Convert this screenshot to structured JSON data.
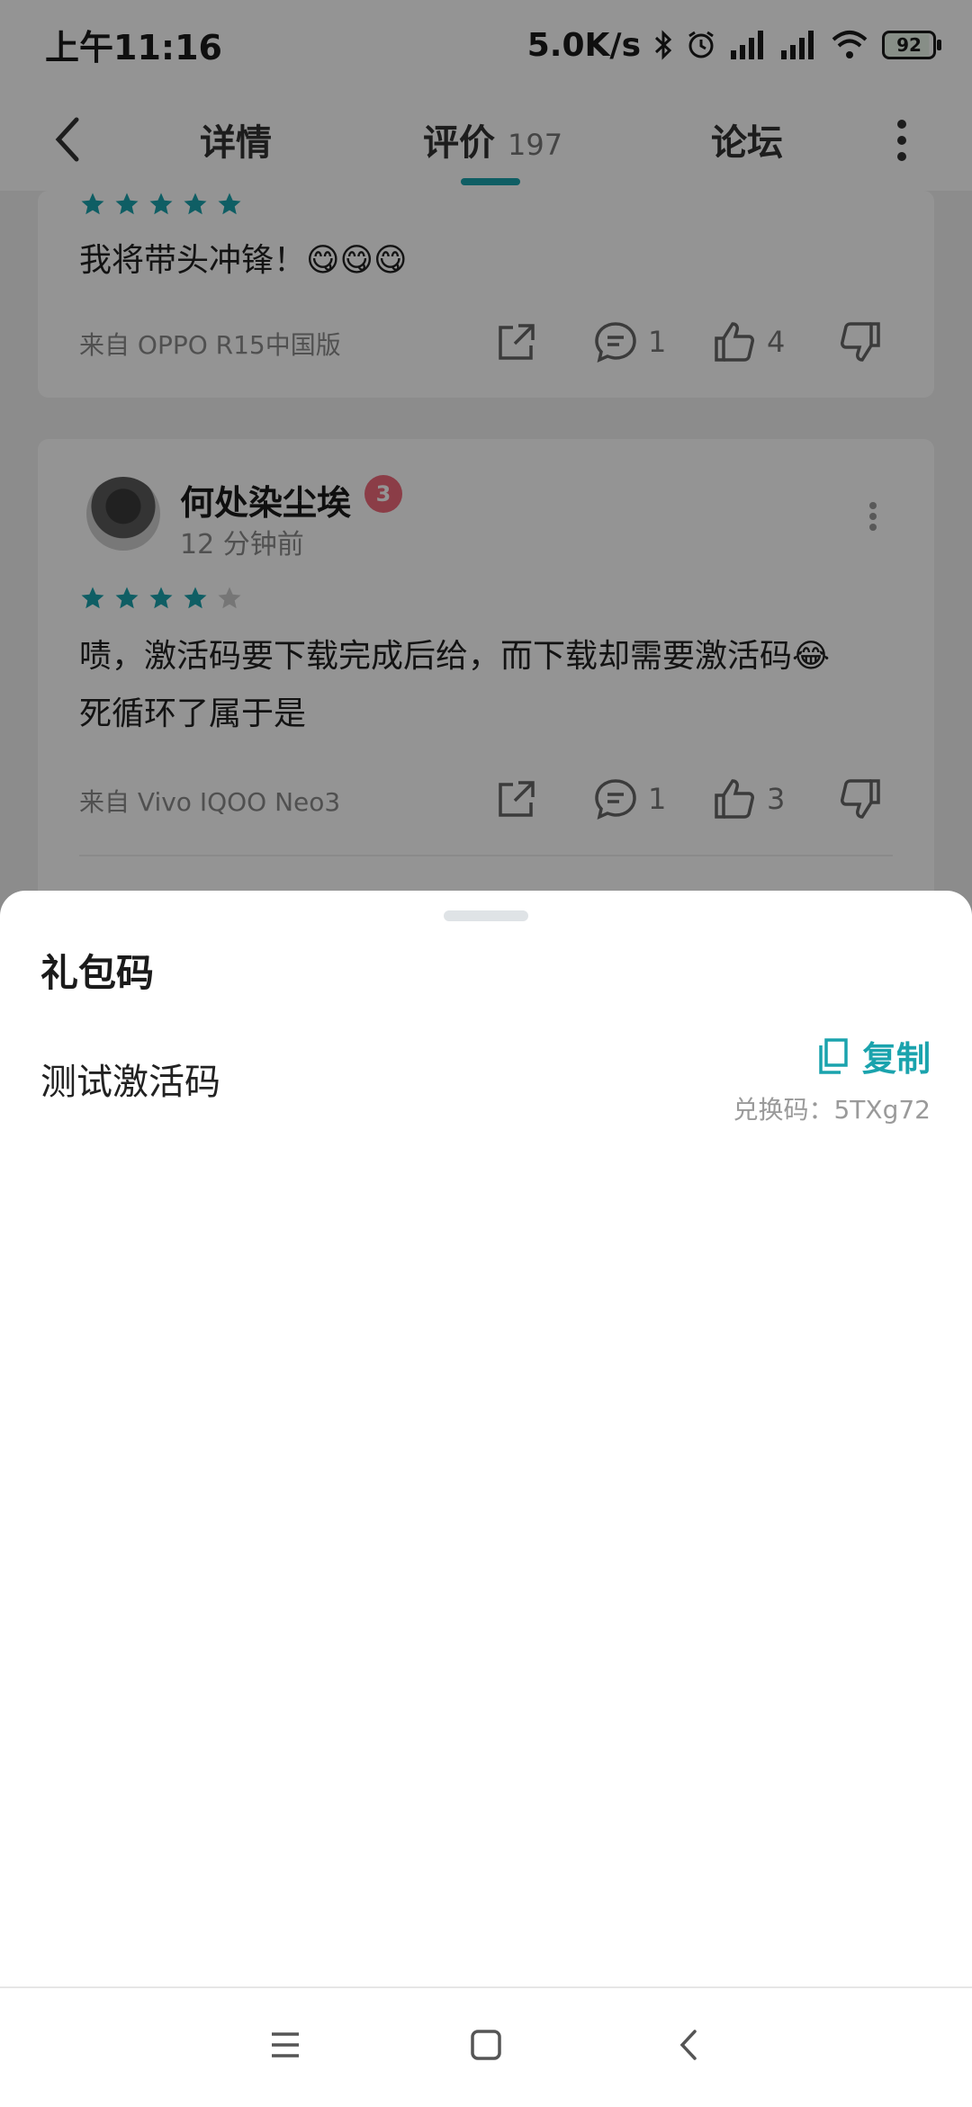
{
  "status": {
    "time": "上午11:16",
    "net_speed": "5.0K/s",
    "battery": "92"
  },
  "header": {
    "tabs": [
      {
        "label": "详情"
      },
      {
        "label": "评价",
        "count": "197"
      },
      {
        "label": "论坛"
      }
    ]
  },
  "reviews": [
    {
      "stars": 5,
      "text": "我将带头冲锋！😋😋😋",
      "device": "来自 OPPO R15中国版",
      "comments": "1",
      "likes": "4"
    },
    {
      "user": "何处染尘埃",
      "badge": "3",
      "time": "12 分钟前",
      "stars": 4,
      "text_line1": "啧，激活码要下载完成后给，而下载却需要激活码😂",
      "text_line2": "死循环了属于是",
      "device": "来自 Vivo IQOO Neo3",
      "comments": "1",
      "likes": "3"
    }
  ],
  "sheet": {
    "title": "礼包码",
    "gift_name": "测试激活码",
    "copy_label": "复制",
    "code_label": "兑换码：5TXg72"
  },
  "colors": {
    "accent": "#1aa3ad",
    "star_empty": "#cccccc"
  }
}
